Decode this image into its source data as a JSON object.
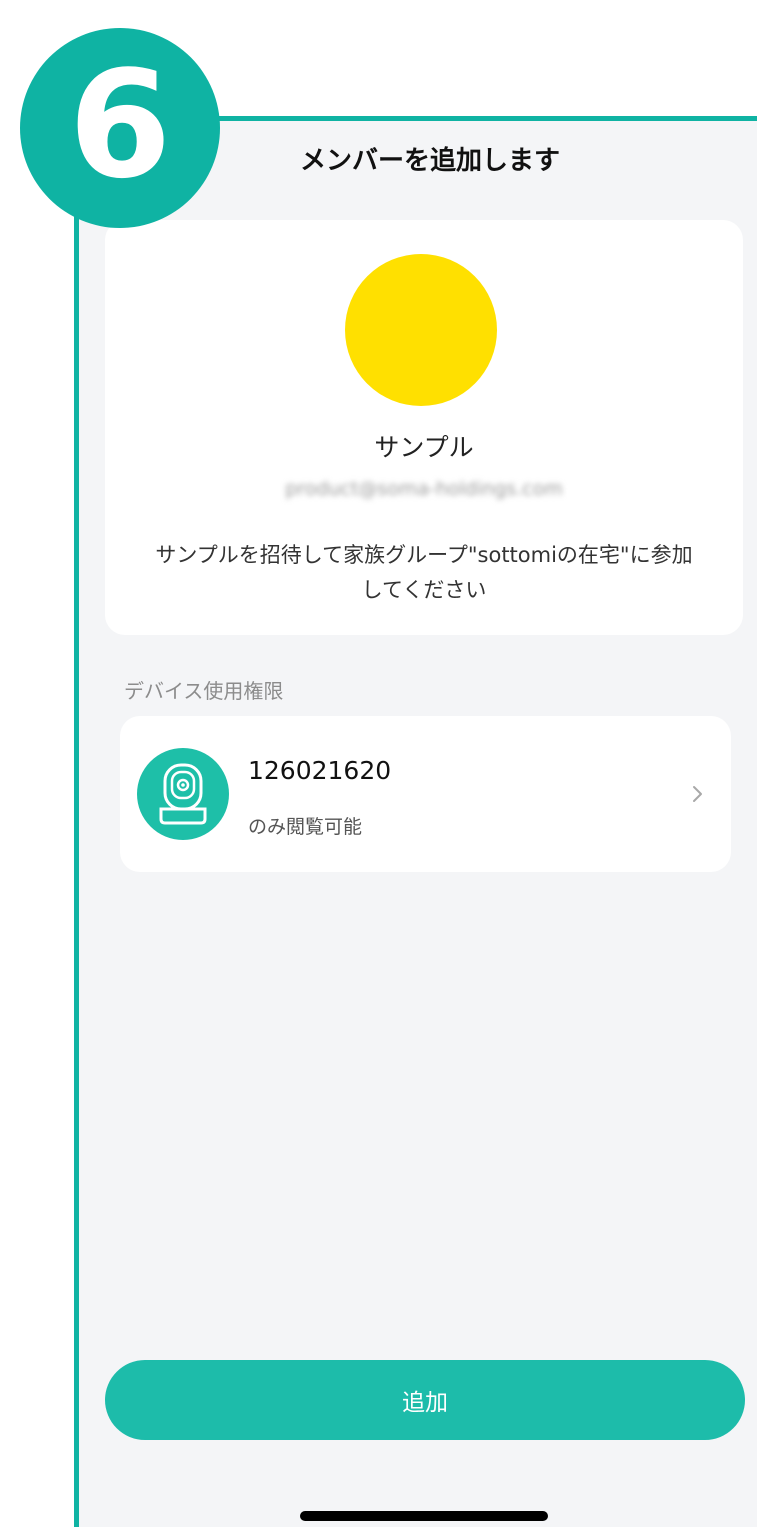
{
  "step": {
    "number": "6"
  },
  "header": {
    "title": "メンバーを追加します"
  },
  "profile": {
    "name": "サンプル",
    "email": "product@soma-holdings.com",
    "invite_message": "サンプルを招待して家族グループ\"sottomiの在宅\"に参加してください",
    "avatar_color": "#ffe000"
  },
  "permissions": {
    "section_label": "デバイス使用権限",
    "device": {
      "name": "126021620",
      "permission": "のみ閲覧可能",
      "icon": "camera-icon"
    }
  },
  "actions": {
    "add_label": "追加"
  },
  "colors": {
    "accent": "#0fb3a3",
    "button": "#1dbcaa",
    "background": "#f4f5f7"
  }
}
